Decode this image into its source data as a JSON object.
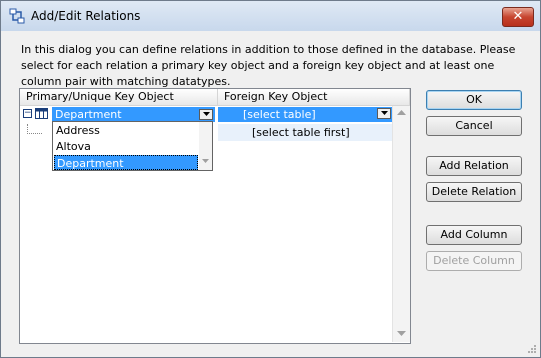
{
  "window": {
    "title": "Add/Edit Relations",
    "close_glyph": "✕",
    "icon": "relations-app-icon"
  },
  "intro_text": "In this dialog you can define relations in addition to those defined in the database.  Please select for each relation a primary key object and a foreign key object and at least one column pair with matching datatypes.",
  "grid": {
    "columns": [
      "Primary/Unique Key Object",
      "Foreign Key Object"
    ],
    "row1": {
      "expander": "−",
      "primary_value": "Department",
      "foreign_value": "[select table]"
    },
    "row2": {
      "foreign_value": "[select table first]"
    },
    "dropdown_options": [
      "Address",
      "Altova",
      "Department"
    ],
    "dropdown_selected": "Department"
  },
  "buttons": {
    "ok": "OK",
    "cancel": "Cancel",
    "add_relation": "Add Relation",
    "delete_relation": "Delete Relation",
    "add_column": "Add Column",
    "delete_column": "Delete Column"
  },
  "colors": {
    "selection": "#3399ff",
    "title_bar": "#c8d8ec",
    "close_button": "#c7452f"
  }
}
